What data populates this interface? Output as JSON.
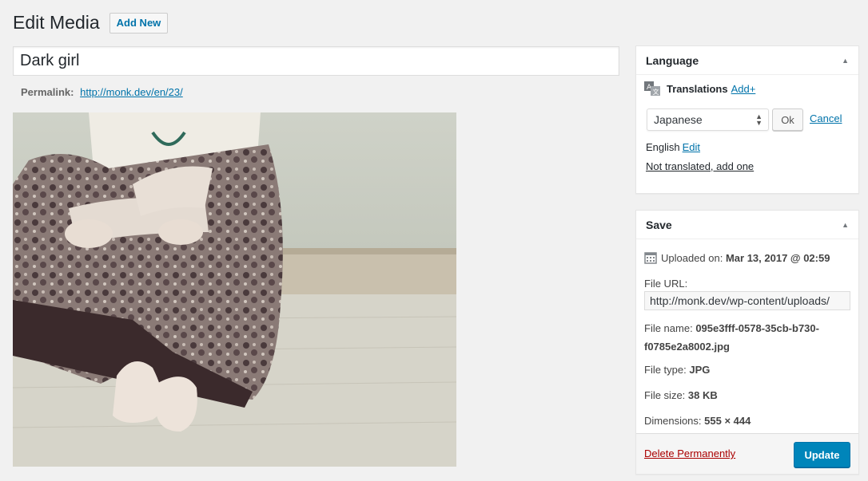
{
  "header": {
    "title": "Edit Media",
    "add_new_label": "Add New"
  },
  "media": {
    "title_value": "Dark girl",
    "permalink_label": "Permalink:",
    "permalink_url": "http://monk.dev/en/23/"
  },
  "language_box": {
    "title": "Language",
    "translations_label": "Translations",
    "add_link": "Add+",
    "selected_language": "Japanese",
    "ok_label": "Ok",
    "cancel_label": "Cancel",
    "english_label": "English",
    "edit_label": "Edit",
    "not_translated_label": "Not translated, add one"
  },
  "save_box": {
    "title": "Save",
    "uploaded_label": "Uploaded on:",
    "uploaded_value": "Mar 13, 2017 @ 02:59",
    "file_url_label": "File URL:",
    "file_url_value": "http://monk.dev/wp-content/uploads/",
    "file_name_label": "File name:",
    "file_name_value": "095e3fff-0578-35cb-b730-f0785e2a8002.jpg",
    "file_type_label": "File type:",
    "file_type_value": "JPG",
    "file_size_label": "File size:",
    "file_size_value": "38 KB",
    "dimensions_label": "Dimensions:",
    "dimensions_value": "555 × 444",
    "delete_label": "Delete Permanently",
    "update_label": "Update"
  },
  "colors": {
    "primary_button": "#0085ba",
    "link": "#0073aa",
    "delete": "#a00",
    "background": "#f1f1f1"
  }
}
